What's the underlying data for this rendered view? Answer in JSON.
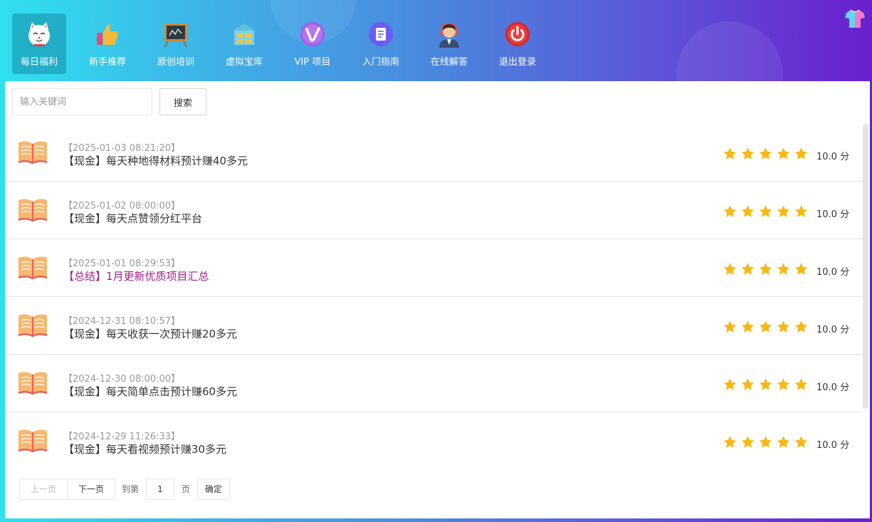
{
  "nav": {
    "items": [
      {
        "label": "每日福利",
        "icon": "lucky-cat-icon",
        "active": true
      },
      {
        "label": "新手推荐",
        "icon": "thumbs-up-icon",
        "active": false
      },
      {
        "label": "原创培训",
        "icon": "chalkboard-icon",
        "active": false
      },
      {
        "label": "虚拟宝库",
        "icon": "treasury-icon",
        "active": false
      },
      {
        "label": "VIP 项目",
        "icon": "vip-icon",
        "active": false
      },
      {
        "label": "入门指南",
        "icon": "document-icon",
        "active": false
      },
      {
        "label": "在线解答",
        "icon": "support-agent-icon",
        "active": false
      },
      {
        "label": "退出登录",
        "icon": "power-icon",
        "active": false
      }
    ]
  },
  "search": {
    "placeholder": "输入关键词",
    "value": "",
    "button_label": "搜索"
  },
  "list": {
    "items": [
      {
        "date": "【2025-01-03 08:21:20】",
        "title": "【现金】每天种地得材料预计赚40多元",
        "stars": 5,
        "score": "10.0 分",
        "highlight": false
      },
      {
        "date": "【2025-01-02 08:00:00】",
        "title": "【现金】每天点赞领分红平台",
        "stars": 5,
        "score": "10.0 分",
        "highlight": false
      },
      {
        "date": "【2025-01-01 08:29:53】",
        "title": "【总结】1月更新优质项目汇总",
        "stars": 5,
        "score": "10.0 分",
        "highlight": true
      },
      {
        "date": "【2024-12-31 08:10:57】",
        "title": "【现金】每天收获一次预计赚20多元",
        "stars": 5,
        "score": "10.0 分",
        "highlight": false
      },
      {
        "date": "【2024-12-30 08:00:00】",
        "title": "【现金】每天简单点击预计赚60多元",
        "stars": 5,
        "score": "10.0 分",
        "highlight": false
      },
      {
        "date": "【2024-12-29 11:26:33】",
        "title": "【现金】每天看视频预计赚30多元",
        "stars": 5,
        "score": "10.0 分",
        "highlight": false
      }
    ]
  },
  "pagination": {
    "prev_label": "上一页",
    "next_label": "下一页",
    "goto_label": "到第",
    "page_value": "1",
    "page_unit": "页",
    "confirm_label": "确定"
  },
  "colors": {
    "accent_highlight": "#a41e8a",
    "star": "#f7b814"
  }
}
